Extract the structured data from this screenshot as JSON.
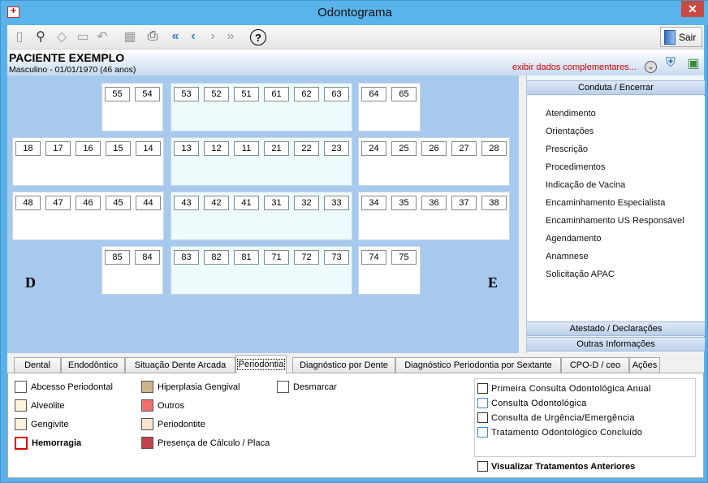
{
  "window": {
    "title": "Odontograma",
    "close_label": "✕"
  },
  "toolbar": {
    "buttons": [
      {
        "icon": "new-record-icon",
        "glyph": "▯"
      },
      {
        "icon": "binoculars-icon",
        "glyph": "⚲"
      },
      {
        "icon": "eraser-icon",
        "glyph": "◇"
      },
      {
        "icon": "trash-icon",
        "glyph": "🗑"
      },
      {
        "icon": "undo-icon",
        "glyph": "↶"
      },
      {
        "icon": "save-icon",
        "glyph": "▦"
      },
      {
        "icon": "printer-icon",
        "glyph": "⎙"
      },
      {
        "icon": "first-icon",
        "glyph": "«"
      },
      {
        "icon": "previous-icon",
        "glyph": "‹"
      },
      {
        "icon": "next-icon",
        "glyph": "›"
      },
      {
        "icon": "last-icon",
        "glyph": "»"
      },
      {
        "icon": "help-icon",
        "glyph": "?"
      }
    ],
    "exit_label": "Sair"
  },
  "patient": {
    "name": "PACIENTE EXEMPLO",
    "info": "Masculino - 01/01/1970 (46 anos)",
    "extra_link": "exibir dados complementares..."
  },
  "odontogram": {
    "rows": [
      {
        "groups": [
          [
            "55",
            "54"
          ],
          [
            "53",
            "52",
            "51",
            "61",
            "62",
            "63"
          ],
          [
            "64",
            "65"
          ]
        ]
      },
      {
        "groups": [
          [
            "18",
            "17",
            "16",
            "15",
            "14"
          ],
          [
            "13",
            "12",
            "11",
            "21",
            "22",
            "23"
          ],
          [
            "24",
            "25",
            "26",
            "27",
            "28"
          ]
        ]
      },
      {
        "groups": [
          [
            "48",
            "47",
            "46",
            "45",
            "44"
          ],
          [
            "43",
            "42",
            "41",
            "31",
            "32",
            "33"
          ],
          [
            "34",
            "35",
            "36",
            "37",
            "38"
          ]
        ]
      },
      {
        "groups": [
          [
            "85",
            "84"
          ],
          [
            "83",
            "82",
            "81",
            "71",
            "72",
            "73"
          ],
          [
            "74",
            "75"
          ]
        ]
      }
    ],
    "right_label": "D",
    "left_label": "E"
  },
  "side_panel": {
    "header": "Conduta / Encerrar",
    "items": [
      "Atendimento",
      "Orientações",
      "Prescrição",
      "Procedimentos",
      "Indicação de Vacina",
      "Encaminhamento Especialista",
      "Encaminhamento US Responsável",
      "Agendamento",
      "Anamnese",
      "Solicitação APAC"
    ],
    "footer1": "Atestado / Declarações",
    "footer2": "Outras Informações"
  },
  "tabs": [
    "Dental",
    "Endodôntico",
    "Situação Dente Arcada",
    "Periodontia",
    "Diagnóstico por Dente",
    "Diagnóstico Periodontia por Sextante",
    "CPO-D / ceo",
    "Ações"
  ],
  "active_tab": "Periodontia",
  "legend": [
    {
      "label": "Abcesso Periodontal",
      "color": "#ffffff"
    },
    {
      "label": "Alveolite",
      "color": "#fff5dc"
    },
    {
      "label": "Gengivite",
      "color": "#fdf1dd"
    },
    {
      "label": "Hemorragia",
      "color": "#ffffff"
    },
    {
      "label": "Hiperplasia Gengival",
      "color": "#d2b48c"
    },
    {
      "label": "Outros",
      "color": "#f07070"
    },
    {
      "label": "Periodontite",
      "color": "#fbe3cc"
    },
    {
      "label": "Presença de Cálculo / Placa",
      "color": "#c0434a"
    },
    {
      "label": "Desmarcar",
      "color": "#ffffff"
    }
  ],
  "consultation": {
    "options": [
      "Primeira Consulta Odontológica Anual",
      "Consulta Odontológica",
      "Consulta de Urgência/Emergência",
      "Tratamento Odontológico Concluído"
    ],
    "previous_treatments": "Visualizar Tratamentos Anteriores"
  }
}
